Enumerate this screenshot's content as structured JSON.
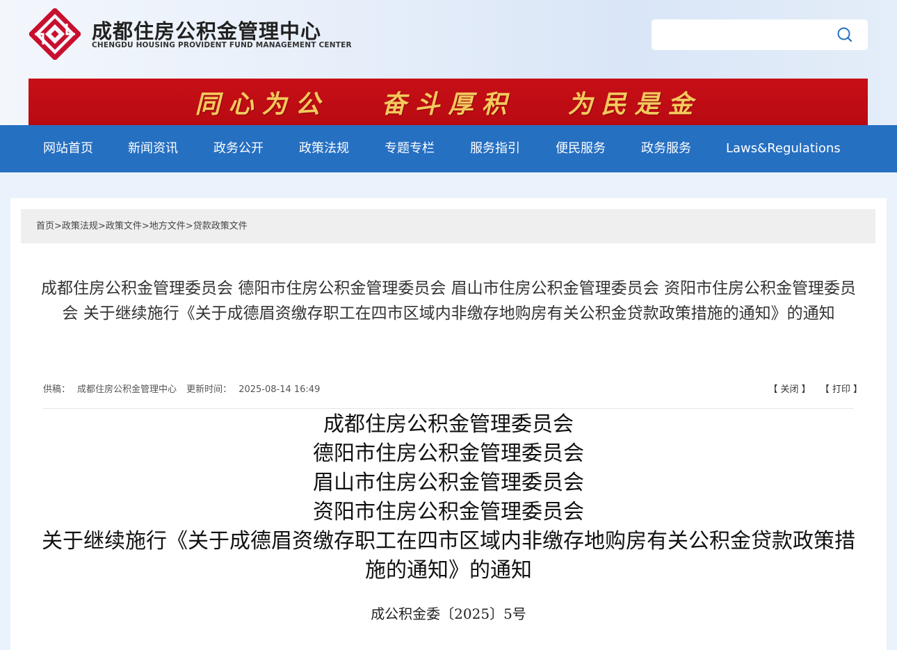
{
  "header": {
    "site_name": "成都住房公积金管理中心",
    "site_name_en": "CHENGDU HOUSING PROVIDENT FUND MANAGEMENT CENTER",
    "search": {
      "placeholder": "",
      "value": ""
    },
    "logo_color": "#c8102e"
  },
  "banner": {
    "slogans": [
      "同心为公",
      "奋斗厚积",
      "为民是金"
    ],
    "background_color": "#c80f17",
    "text_color": "#f4c95e"
  },
  "nav": {
    "color": "#2670c2",
    "items": [
      "网站首页",
      "新闻资讯",
      "政务公开",
      "政策法规",
      "专题专栏",
      "服务指引",
      "便民服务",
      "政务服务",
      "Laws&Regulations"
    ]
  },
  "breadcrumb": {
    "items": [
      "首页",
      "政策法规",
      "政策文件",
      "地方文件",
      "贷款政策文件"
    ],
    "separator": ">"
  },
  "article": {
    "title": "成都住房公积金管理委员会 德阳市住房公积金管理委员会 眉山市住房公积金管理委员会 资阳市住房公积金管理委员会 关于继续施行《关于成德眉资缴存职工在四市区域内非缴存地购房有关公积金贷款政策措施的通知》的通知",
    "source_label": "供稿：",
    "source": "成都住房公积金管理中心",
    "updated_label": "更新时间：",
    "updated": "2025-08-14 16:49",
    "close_label": "【 关闭 】",
    "print_label": "【 打印 】",
    "heading_lines": [
      "成都住房公积金管理委员会",
      "德阳市住房公积金管理委员会",
      "眉山市住房公积金管理委员会",
      "资阳市住房公积金管理委员会",
      "关于继续施行《关于成德眉资缴存职工在四市区域内非缴存地购房有关公积金贷款政策措施的通知》的通知"
    ],
    "doc_number": "成公积金委〔2025〕5号"
  }
}
